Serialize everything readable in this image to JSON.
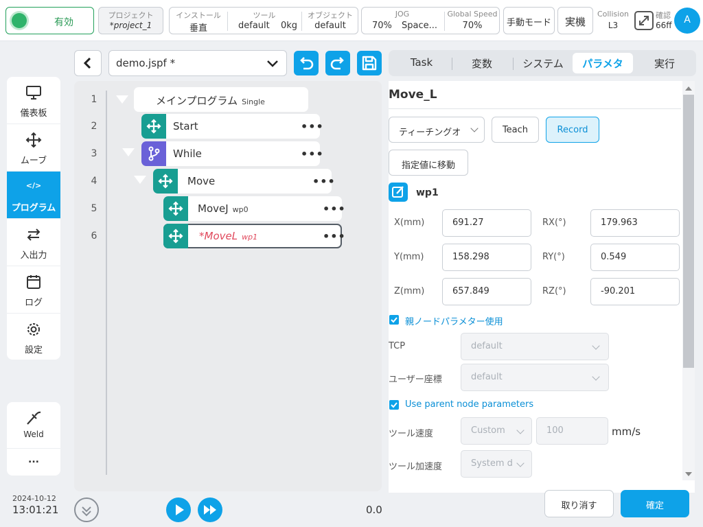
{
  "topbar": {
    "enable_label": "有効",
    "project": {
      "label": "プロジェクト",
      "value": "*project_1"
    },
    "install": {
      "label": "インストール",
      "value": "垂直"
    },
    "tool": {
      "label": "ツール",
      "value": "default",
      "weight": "0kg"
    },
    "object": {
      "label": "オブジェクト",
      "value": "default"
    },
    "jog": {
      "label": "JOG",
      "speed": "70%",
      "value": "Space..."
    },
    "global_speed": {
      "label": "Global Speed",
      "value": "70%"
    },
    "manual_mode": "手動モード",
    "real_machine": "実機",
    "collision": {
      "label": "Collision",
      "value": "L3"
    },
    "confirm": {
      "label": "確認",
      "value": "66ff"
    },
    "avatar": "A"
  },
  "sidebar": {
    "items": [
      {
        "label": "儀表板",
        "icon": "monitor-icon"
      },
      {
        "label": "ムーブ",
        "icon": "move-icon"
      },
      {
        "label": "プログラム",
        "icon": "code-icon"
      },
      {
        "label": "入出力",
        "icon": "swap-icon"
      },
      {
        "label": "ログ",
        "icon": "calendar-icon"
      },
      {
        "label": "設定",
        "icon": "gear-icon"
      }
    ],
    "weld_label": "Weld",
    "more_label": "...",
    "date": "2024-10-12",
    "time": "13:01:21"
  },
  "editor": {
    "file_name": "demo.jspf *",
    "line_numbers": [
      "1",
      "2",
      "3",
      "4",
      "5",
      "6"
    ],
    "nodes": {
      "main": {
        "name": "メインプログラム",
        "tag": "Single"
      },
      "start": {
        "name": "Start"
      },
      "while": {
        "name": "While"
      },
      "move": {
        "name": "Move"
      },
      "movej": {
        "name": "MoveJ",
        "tag": "wp0"
      },
      "movel": {
        "name": "*MoveL",
        "tag": "wp1"
      }
    },
    "dots": "•••",
    "counter": "0.0"
  },
  "tabs": [
    "Task",
    "変数",
    "システム",
    "パラメタ",
    "実行"
  ],
  "panel": {
    "title": "Move_L",
    "teaching_select": "ティーチングオ",
    "teach_button": "Teach",
    "record_button": "Record",
    "move_to_button": "指定値に移動",
    "waypoint": "wp1",
    "fields": {
      "x": {
        "label": "X(mm)",
        "value": "691.27"
      },
      "y": {
        "label": "Y(mm)",
        "value": "158.298"
      },
      "z": {
        "label": "Z(mm)",
        "value": "657.849"
      },
      "rx": {
        "label": "RX(°)",
        "value": "179.963"
      },
      "ry": {
        "label": "RY(°)",
        "value": "0.549"
      },
      "rz": {
        "label": "RZ(°)",
        "value": "-90.201"
      }
    },
    "parent_params_jp": "親ノードパラメター使用",
    "tcp": {
      "label": "TCP",
      "value": "default"
    },
    "user_coord": {
      "label": "ユーザー座標",
      "value": "default"
    },
    "parent_params_en": "Use parent node parameters",
    "tool_speed": {
      "label": "ツール速度",
      "mode": "Custom",
      "value": "100",
      "unit": "mm/s"
    },
    "tool_accel": {
      "label": "ツール加速度",
      "mode": "System d"
    },
    "cancel_button": "取り消す",
    "ok_button": "確定"
  },
  "colors": {
    "accent": "#0ea2e8",
    "teal": "#189e92",
    "purple": "#6a61d8",
    "error_red": "#e0475b"
  }
}
